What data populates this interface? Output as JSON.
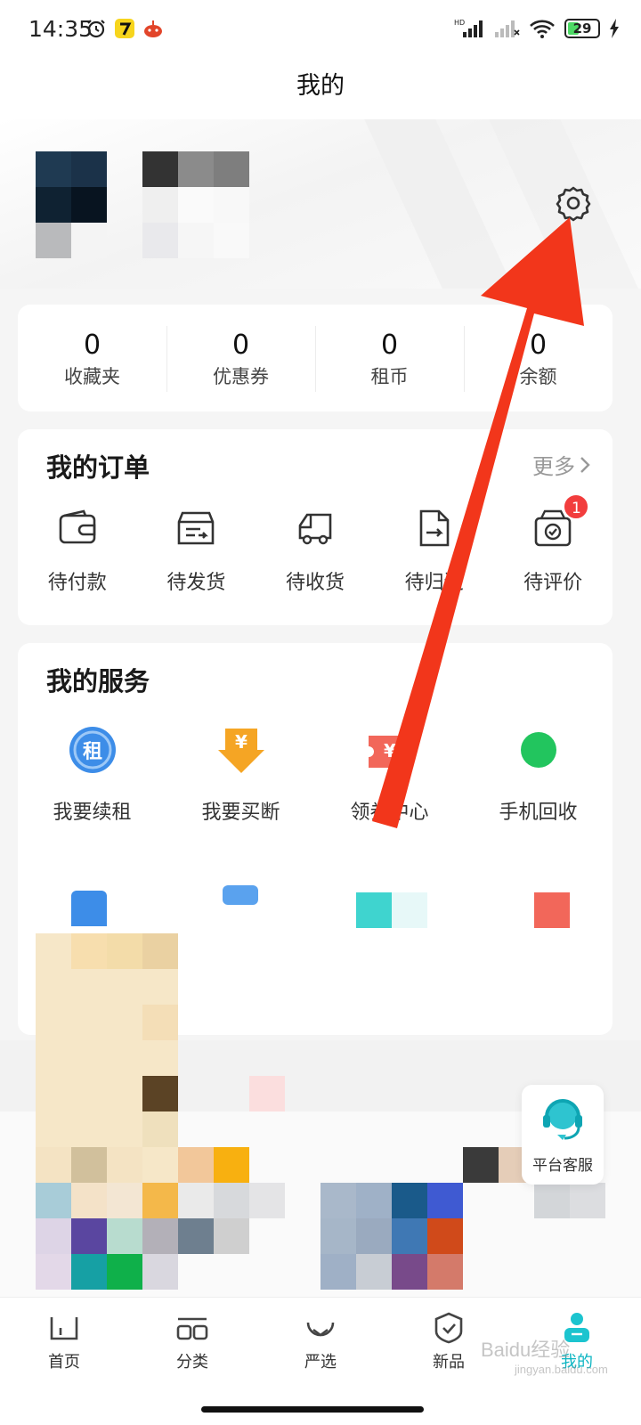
{
  "status_bar": {
    "time": "14:35",
    "battery_level": "29",
    "icons": [
      "alarm-icon",
      "app-icon",
      "app-icon",
      "hd-signal-icon",
      "signal-icon",
      "wifi-icon",
      "battery-icon",
      "charging-icon"
    ]
  },
  "page": {
    "title": "我的"
  },
  "stats": [
    {
      "value": "0",
      "label": "收藏夹"
    },
    {
      "value": "0",
      "label": "优惠券"
    },
    {
      "value": "0",
      "label": "租币"
    },
    {
      "value": "0",
      "label": "余额"
    }
  ],
  "orders": {
    "title": "我的订单",
    "more_label": "更多",
    "items": [
      {
        "label": "待付款",
        "icon": "wallet-icon"
      },
      {
        "label": "待发货",
        "icon": "box-icon"
      },
      {
        "label": "待收货",
        "icon": "truck-icon"
      },
      {
        "label": "待归还",
        "icon": "return-doc-icon"
      },
      {
        "label": "待评价",
        "icon": "review-icon",
        "badge": "1"
      }
    ]
  },
  "services": {
    "title": "我的服务",
    "items": [
      {
        "label": "我要续租",
        "icon": "renew-icon",
        "icon_text": "租"
      },
      {
        "label": "我要买断",
        "icon": "buyout-icon",
        "icon_text": "¥"
      },
      {
        "label": "领券中心",
        "icon": "coupon-icon",
        "icon_text": "¥"
      },
      {
        "label": "手机回收",
        "icon": "recycle-icon"
      }
    ]
  },
  "customer_service": {
    "label": "平台客服"
  },
  "bottom_nav": {
    "items": [
      {
        "label": "首页",
        "icon": "home-icon"
      },
      {
        "label": "分类",
        "icon": "category-icon"
      },
      {
        "label": "严选",
        "icon": "select-icon"
      },
      {
        "label": "新品",
        "icon": "new-product-icon"
      },
      {
        "label": "我的",
        "icon": "profile-icon",
        "active": true
      }
    ]
  },
  "watermark": {
    "text": "Baidu经验",
    "sub": "jingyan.baidu.com"
  },
  "colors": {
    "accent": "#0bb5c2",
    "badge": "#f23d3d",
    "annotation_arrow": "#f2361b"
  }
}
